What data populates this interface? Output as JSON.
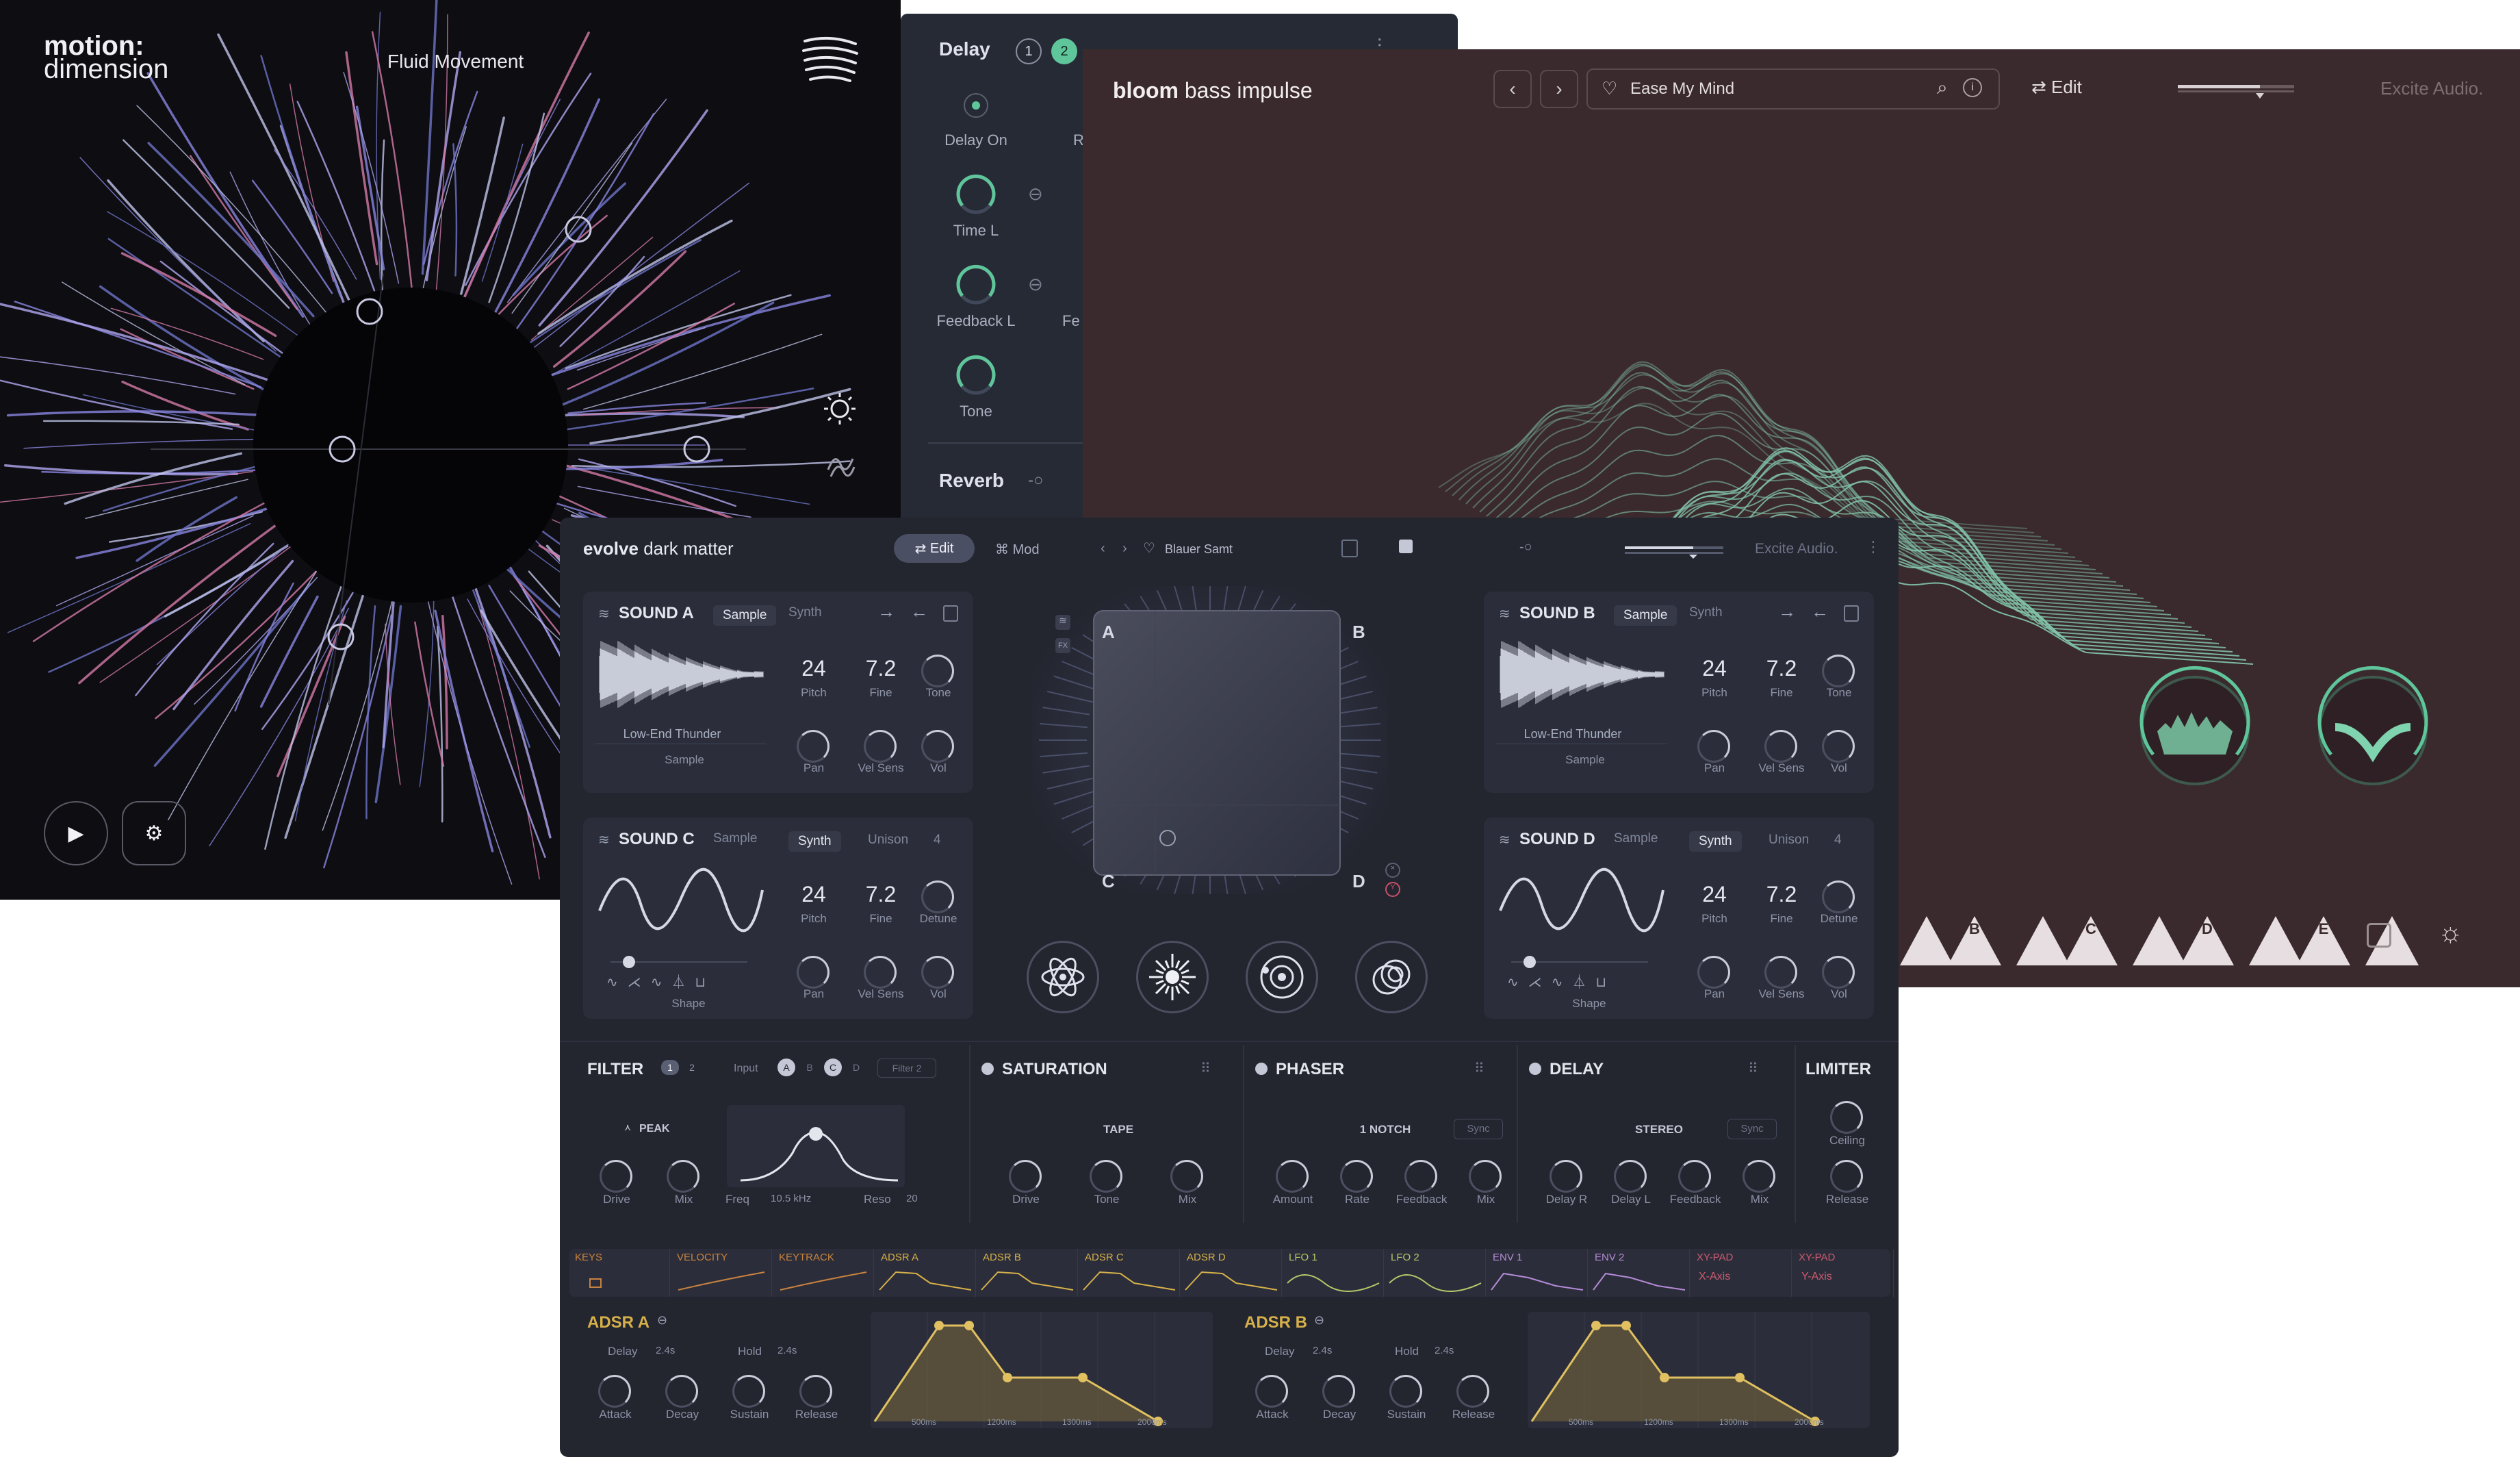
{
  "motion": {
    "logo_line1": "motion:",
    "logo_line2": "dimension",
    "preset": "Fluid Movement",
    "play_icon": "▶",
    "gear_icon": "⚙"
  },
  "delay_panel": {
    "title": "Delay",
    "tab1": "1",
    "tab2": "2",
    "delay_on": "Delay On",
    "partial_r": "R",
    "time_l": "Time L",
    "feedback_l": "Feedback L",
    "partial_fe": "Fe",
    "tone": "Tone",
    "reverb": "Reverb"
  },
  "bloom": {
    "brand_bold": "bloom",
    "brand_rest": "bass impulse",
    "preset": "Ease My Mind",
    "edit": "Edit",
    "vendor": "Excite Audio.",
    "pads": [
      "B",
      "C",
      "D",
      "E"
    ]
  },
  "evolve": {
    "brand_bold": "evolve",
    "brand_rest": "dark matter",
    "edit": "Edit",
    "mod": "Mod",
    "preset": "Blauer Samt",
    "vendor": "Excite Audio.",
    "sounds": [
      {
        "title": "SOUND A",
        "tab1": "Sample",
        "tab2": "Synth",
        "pitch": "24",
        "fine": "7.2",
        "knob3": "Tone",
        "sample_name": "Low-End Thunder",
        "sub": "Sample"
      },
      {
        "title": "SOUND B",
        "tab1": "Sample",
        "tab2": "Synth",
        "pitch": "24",
        "fine": "7.2",
        "knob3": "Tone",
        "sample_name": "Low-End Thunder",
        "sub": "Sample"
      },
      {
        "title": "SOUND C",
        "tab1": "Sample",
        "tab2": "Synth",
        "unison": "Unison",
        "unison_val": "4",
        "pitch": "24",
        "fine": "7.2",
        "knob3": "Detune",
        "sub": "Shape"
      },
      {
        "title": "SOUND D",
        "tab1": "Sample",
        "tab2": "Synth",
        "unison": "Unison",
        "unison_val": "4",
        "pitch": "24",
        "fine": "7.2",
        "knob3": "Detune",
        "sub": "Shape"
      }
    ],
    "labels": {
      "pitch": "Pitch",
      "fine": "Fine",
      "pan": "Pan",
      "vel_sens": "Vel Sens",
      "vol": "Vol"
    },
    "xy": {
      "a": "A",
      "b": "B",
      "c": "C",
      "d": "D",
      "fx": "FX"
    },
    "filter": {
      "title": "FILTER",
      "n1": "1",
      "n2": "2",
      "input": "Input",
      "a": "A",
      "b": "B",
      "c": "C",
      "d": "D",
      "filter2": "Filter 2",
      "type": "PEAK",
      "drive": "Drive",
      "mix": "Mix",
      "freq": "Freq",
      "freq_val": "10.5 kHz",
      "reso": "Reso",
      "reso_val": "20"
    },
    "saturation": {
      "title": "SATURATION",
      "mode": "TAPE",
      "drive": "Drive",
      "tone": "Tone",
      "mix": "Mix"
    },
    "phaser": {
      "title": "PHASER",
      "mode": "1 NOTCH",
      "sync": "Sync",
      "amount": "Amount",
      "rate": "Rate",
      "feedback": "Feedback",
      "mix": "Mix"
    },
    "delay": {
      "title": "DELAY",
      "mode": "STEREO",
      "sync": "Sync",
      "delay_r": "Delay R",
      "delay_l": "Delay L",
      "feedback": "Feedback",
      "mix": "Mix"
    },
    "limiter": {
      "title": "LIMITER",
      "ceiling": "Ceiling",
      "release": "Release"
    },
    "mod_tabs": [
      "KEYS",
      "VELOCITY",
      "KEYTRACK",
      "ADSR A",
      "ADSR B",
      "ADSR C",
      "ADSR D",
      "LFO 1",
      "LFO 2",
      "ENV 1",
      "ENV 2",
      "XY-PAD",
      "XY-PAD"
    ],
    "x_axis": "X-Axis",
    "y_axis": "Y-Axis",
    "adsr_a": {
      "title": "ADSR A",
      "delay": "Delay",
      "delay_val": "2.4s",
      "hold": "Hold",
      "hold_val": "2.4s",
      "attack": "Attack",
      "decay": "Decay",
      "sustain": "Sustain",
      "release": "Release",
      "t1": "500ms",
      "t2": "1200ms",
      "t3": "1300ms",
      "t4": "2000ms"
    },
    "adsr_b": {
      "title": "ADSR B",
      "delay": "Delay",
      "delay_val": "2.4s",
      "hold": "Hold",
      "hold_val": "2.4s",
      "attack": "Attack",
      "decay": "Decay",
      "sustain": "Sustain",
      "release": "Release",
      "t1": "500ms",
      "t2": "1200ms",
      "t3": "1300ms",
      "t4": "2000ms"
    }
  }
}
